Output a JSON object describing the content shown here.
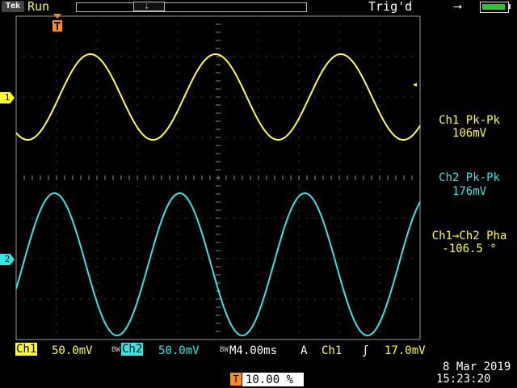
{
  "header": {
    "logo": "Tek",
    "status": "Run",
    "trigger_state": "Trig'd"
  },
  "icons": {
    "power_source": "ac-plug-icon",
    "battery": "battery-icon",
    "trigger_position": "trigger-position-icon"
  },
  "channels": {
    "ch1": {
      "marker": "1",
      "color": "#ffff33"
    },
    "ch2": {
      "marker": "2",
      "color": "#33e6e6"
    }
  },
  "measurements": {
    "ch1_pkpk_label": "Ch1 Pk-Pk",
    "ch1_pkpk_value": "106mV",
    "ch2_pkpk_label": "Ch2 Pk-Pk",
    "ch2_pkpk_value": "176mV",
    "phase_label": "Ch1→Ch2 Pha",
    "phase_value": "-106.5 °"
  },
  "footer": {
    "ch1_label": "Ch1",
    "ch1_scale": "50.0mV",
    "bw_limit_glyph": "BW",
    "ch2_label": "Ch2",
    "ch2_scale": "50.0mV",
    "timebase": "M4.00ms",
    "acq_mode": "A",
    "trig_source": "Ch1",
    "trig_slope": "ʃ",
    "trig_level": "17.0mV",
    "date": "8 Mar  2019",
    "time": "15:23:20",
    "trig_marker": "T",
    "trig_position": "10.00 %"
  },
  "waveforms": {
    "ch1": {
      "color": "#ffff33",
      "peak_to_peak_mV": 106,
      "period_ms": 12.4
    },
    "ch2": {
      "color": "#33e6e6",
      "peak_to_peak_mV": 176,
      "period_ms": 12.4,
      "phase_deg": -106.5
    }
  }
}
